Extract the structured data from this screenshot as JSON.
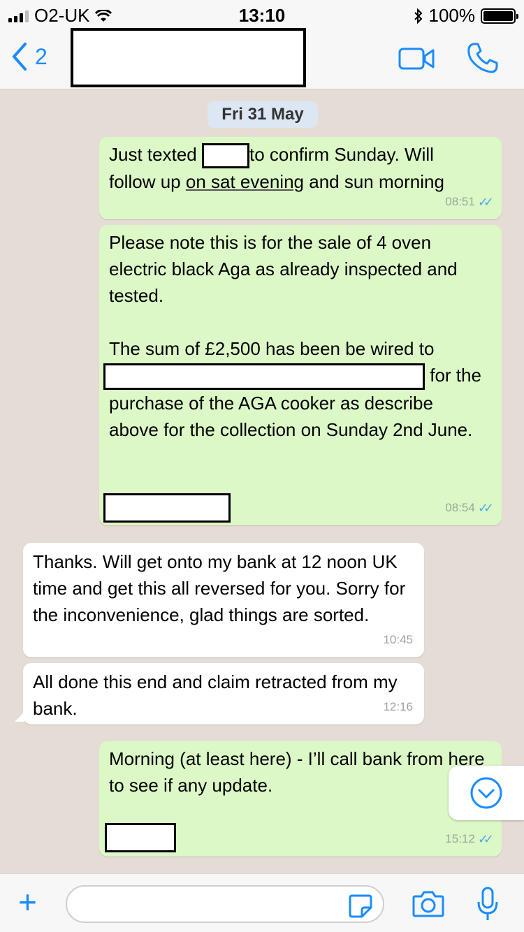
{
  "status": {
    "carrier": "O2-UK",
    "time": "13:10",
    "battery": "100%"
  },
  "header": {
    "back_count": "2"
  },
  "chat": {
    "date": "Fri 31 May",
    "messages": [
      {
        "part1": "Just texted",
        "part2": "to confirm Sunday. Will",
        "line2_a": "follow up",
        "line2_b": "on sat evening",
        "line2_c": "and sun morning",
        "time": "08:51"
      },
      {
        "para1": "Please note this is for the sale of 4 oven electric black Aga as already inspected and tested.",
        "para2_a": "The sum of £2,500 has been be wired to",
        "para2_b": "for the",
        "para2_c": "purchase of the AGA cooker as describe above for the collection on Sunday 2nd June.",
        "time": "08:54"
      },
      {
        "text": "Thanks. Will get onto my bank at 12 noon UK time and get this all reversed for you. Sorry for the inconvenience, glad things are sorted.",
        "time": "10:45"
      },
      {
        "text": "All done this end and claim retracted from my bank.",
        "time": "12:16"
      },
      {
        "text": "Morning (at least here) - I’ll call bank from here to see if any update.",
        "time": "15:12"
      }
    ]
  },
  "input": {
    "placeholder": ""
  },
  "colors": {
    "outgoing_bubble": "#dcf8c6",
    "incoming_bubble": "#ffffff",
    "accent": "#1a8cff",
    "read_ticks": "#4fa8e8"
  },
  "icons": [
    "back-chevron-icon",
    "video-call-icon",
    "phone-call-icon",
    "scroll-down-icon",
    "plus-icon",
    "sticker-icon",
    "camera-icon",
    "microphone-icon",
    "bluetooth-icon",
    "wifi-icon"
  ]
}
